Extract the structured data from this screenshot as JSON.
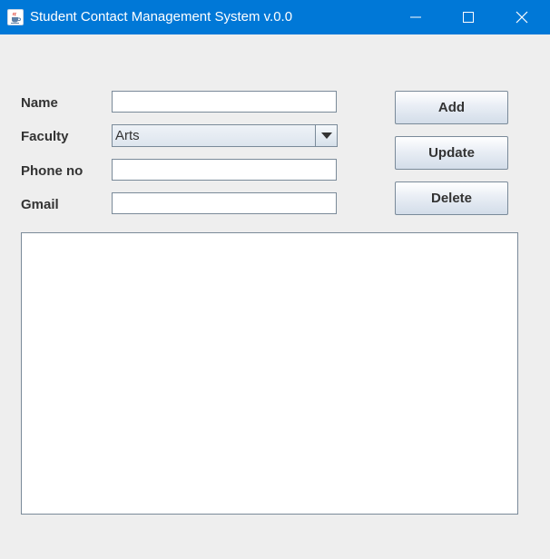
{
  "window": {
    "title": "Student Contact Management System v.0.0",
    "icon": "java-coffee-cup-icon",
    "controls": [
      "minimize-icon",
      "maximize-icon",
      "close-icon"
    ],
    "titlebar_color": "#0078d7"
  },
  "form": {
    "name": {
      "label": "Name",
      "value": ""
    },
    "faculty": {
      "label": "Faculty",
      "selected": "Arts"
    },
    "phone": {
      "label": "Phone no",
      "value": ""
    },
    "gmail": {
      "label": "Gmail",
      "value": ""
    }
  },
  "buttons": {
    "add": "Add",
    "update": "Update",
    "delete": "Delete"
  },
  "output": {
    "text": ""
  }
}
